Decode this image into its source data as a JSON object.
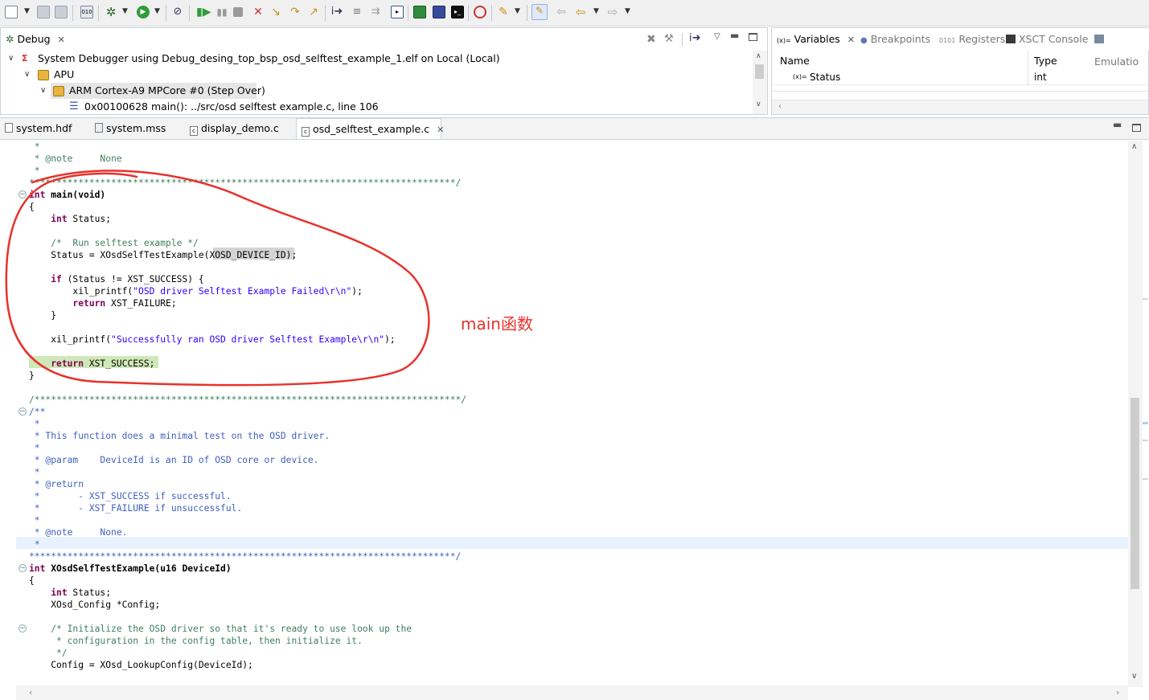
{
  "toolbar": {
    "icons": [
      "new-icon",
      "save-icon",
      "save-all-icon",
      "build-icon",
      "debug-icon",
      "run-icon",
      "skip-breakpoints-icon",
      "resume-icon",
      "suspend-icon",
      "terminate-icon",
      "disconnect-icon",
      "step-into-icon",
      "step-over-icon",
      "step-return-icon",
      "drop-to-frame-icon",
      "instruction-stepping-icon",
      "open-console-icon",
      "program-fpga-icon",
      "xmd-icon",
      "terminal-icon",
      "tcf-icon",
      "launch-icon",
      "pin-icon",
      "back-icon",
      "forward-icon"
    ]
  },
  "debug_view": {
    "tab_label": "Debug",
    "tree": [
      {
        "label": "System Debugger using Debug_desing_top_bsp_osd_selftest_example_1.elf on Local (Local)"
      },
      {
        "label": "APU"
      },
      {
        "label": "ARM Cortex-A9 MPCore #0 (Step Over)"
      },
      {
        "label": "0x00100628 main(): ../src/osd selftest example.c, line 106"
      }
    ]
  },
  "variables_view": {
    "tabs": [
      {
        "label": "Variables",
        "prefix": "(x)="
      },
      {
        "label": "Breakpoints"
      },
      {
        "label": "Registers"
      },
      {
        "label": "XSCT Console"
      },
      {
        "label": "Emulatio"
      }
    ],
    "columns": [
      "Name",
      "Type"
    ],
    "rows": [
      {
        "prefix": "(x)=",
        "name": "Status",
        "type": "int"
      }
    ]
  },
  "editor": {
    "tabs": [
      {
        "label": "system.hdf"
      },
      {
        "label": "system.mss"
      },
      {
        "label": "display_demo.c"
      },
      {
        "label": "osd_selftest_example.c"
      }
    ],
    "lines": [
      " *",
      " * @note     None",
      " *",
      "******************************************************************************/",
      "int main(void)",
      "{",
      "    int Status;",
      "",
      "    /*  Run selftest example */",
      "    Status = XOsdSelfTestExample(XOSD_DEVICE_ID);",
      "",
      "    if (Status != XST_SUCCESS) {",
      "        xil_printf(\"OSD driver Selftest Example Failed\\r\\n\");",
      "        return XST_FAILURE;",
      "    }",
      "",
      "    xil_printf(\"Successfully ran OSD driver Selftest Example\\r\\n\");",
      "",
      "    return XST_SUCCESS;",
      "}",
      "",
      "/******************************************************************************/",
      "/**",
      " *",
      " * This function does a minimal test on the OSD driver.",
      " *",
      " * @param    DeviceId is an ID of OSD core or device.",
      " *",
      " * @return",
      " *       - XST_SUCCESS if successful.",
      " *       - XST_FAILURE if unsuccessful.",
      " *",
      " * @note     None.",
      " *",
      "******************************************************************************/",
      "int XOsdSelfTestExample(u16 DeviceId)",
      "{",
      "    int Status;",
      "    XOsd_Config *Config;",
      "",
      "    /* Initialize the OSD driver so that it's ready to use look up the",
      "     * configuration in the config table, then initialize it.",
      "     */",
      "    Config = XOsd_LookupConfig(DeviceId);"
    ]
  },
  "annotation": {
    "label": "main函数",
    "color": "#e8322c"
  }
}
